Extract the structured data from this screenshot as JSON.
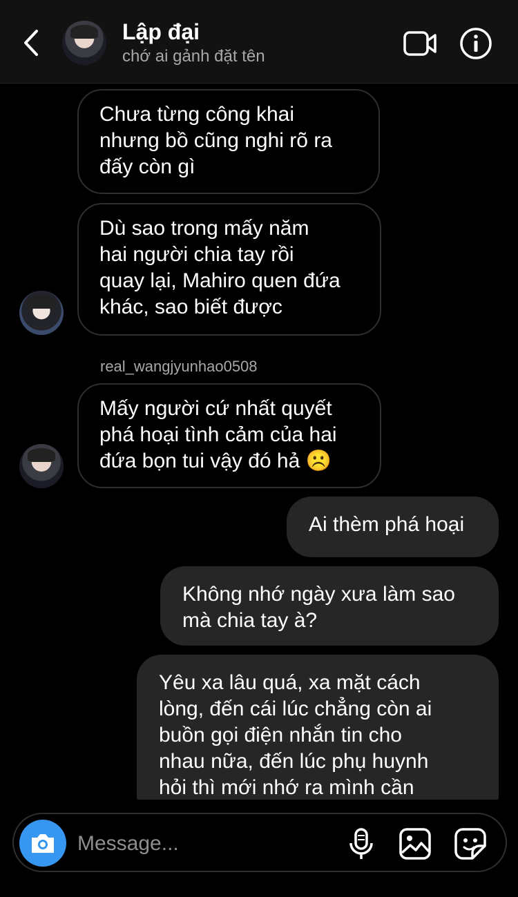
{
  "header": {
    "title": "Lập đại",
    "subtitle": "chớ ai gảnh đặt tên",
    "icons": [
      "back-chevron",
      "video-call",
      "info"
    ]
  },
  "messages": [
    {
      "direction": "in",
      "text": "Chưa từng công khai\nnhưng bồ cũng nghi rõ ra\nđấy còn gì"
    },
    {
      "direction": "in",
      "text": "Dù sao trong mấy năm\nhai người chia tay rồi\nquay lại, Mahiro quen đứa\nkhác, sao biết được"
    },
    {
      "direction": "in",
      "sender": "real_wangjyunhao0508",
      "text": "Mấy người cứ nhất quyết\nphá hoại tình cảm của hai\nđứa bọn tui vậy đó hả ☹️"
    },
    {
      "direction": "out",
      "text": "Ai thèm phá hoại"
    },
    {
      "direction": "out",
      "text": "Không nhớ ngày xưa làm sao\nmà chia tay à?"
    },
    {
      "direction": "out",
      "text": "Yêu xa lâu quá, xa mặt cách\nlòng, đến cái lúc chẳng còn ai\nbuồn gọi điện nhắn tin cho\nnhau nữa, đến lúc phụ huynh\nhỏi thì mới nhớ ra mình cần"
    }
  ],
  "composer": {
    "placeholder": "Message...",
    "icons": [
      "camera",
      "microphone",
      "gallery",
      "sticker"
    ]
  },
  "colors": {
    "background": "#000000",
    "header_bg": "#121212",
    "outgoing_bubble": "#262626",
    "incoming_border": "#2e2e2e",
    "accent_camera": "#3797f0",
    "muted_text": "#a8a8a8"
  }
}
